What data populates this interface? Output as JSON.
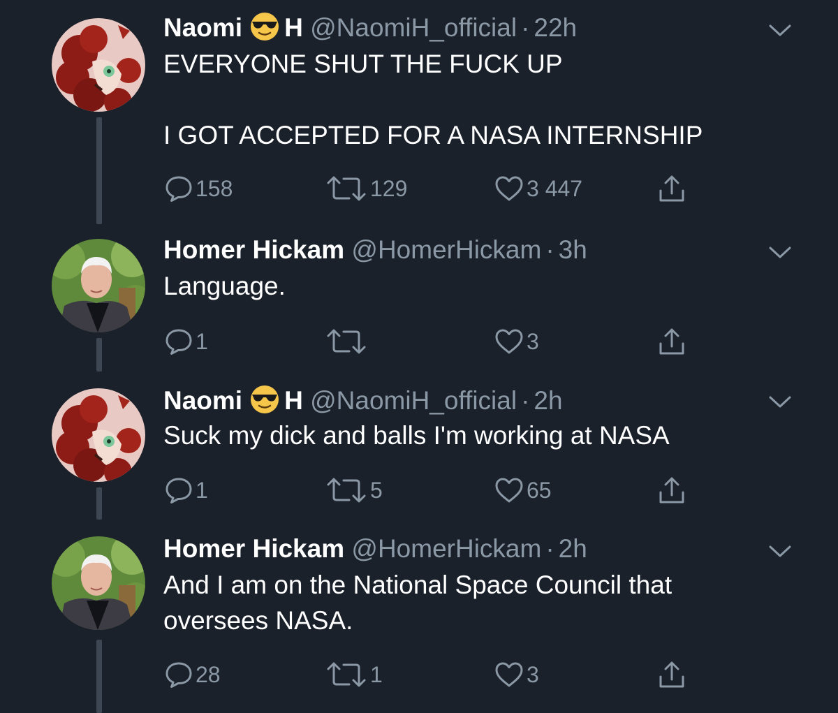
{
  "colors": {
    "background": "#1b212b",
    "text": "#ffffff",
    "muted": "#8b98a5",
    "thread_line": "#3d4653"
  },
  "tweets": [
    {
      "name": "Naomi",
      "emoji": "sunglasses-emoji",
      "name_suffix": "H",
      "handle": "@NaomiH_official",
      "separator": "·",
      "time": "22h",
      "text": "EVERYONE SHUT THE FUCK UP\n\nI GOT ACCEPTED FOR A NASA INTERNSHIP",
      "avatar": "cartoon-character-avatar",
      "replies": "158",
      "retweets": "129",
      "likes": "3 447"
    },
    {
      "name": "Homer Hickam",
      "handle": "@HomerHickam",
      "separator": "·",
      "time": "3h",
      "text": "Language.",
      "avatar": "photo-avatar",
      "replies": "1",
      "retweets": "",
      "likes": "3"
    },
    {
      "name": "Naomi",
      "emoji": "sunglasses-emoji",
      "name_suffix": "H",
      "handle": "@NaomiH_official",
      "separator": "·",
      "time": "2h",
      "text": "Suck my dick and balls I'm working at NASA",
      "avatar": "cartoon-character-avatar",
      "replies": "1",
      "retweets": "5",
      "likes": "65"
    },
    {
      "name": "Homer Hickam",
      "handle": "@HomerHickam",
      "separator": "·",
      "time": "2h",
      "text": "And I am on the National Space Council that\noversees NASA.",
      "avatar": "photo-avatar",
      "replies": "28",
      "retweets": "1",
      "likes": "3"
    }
  ]
}
